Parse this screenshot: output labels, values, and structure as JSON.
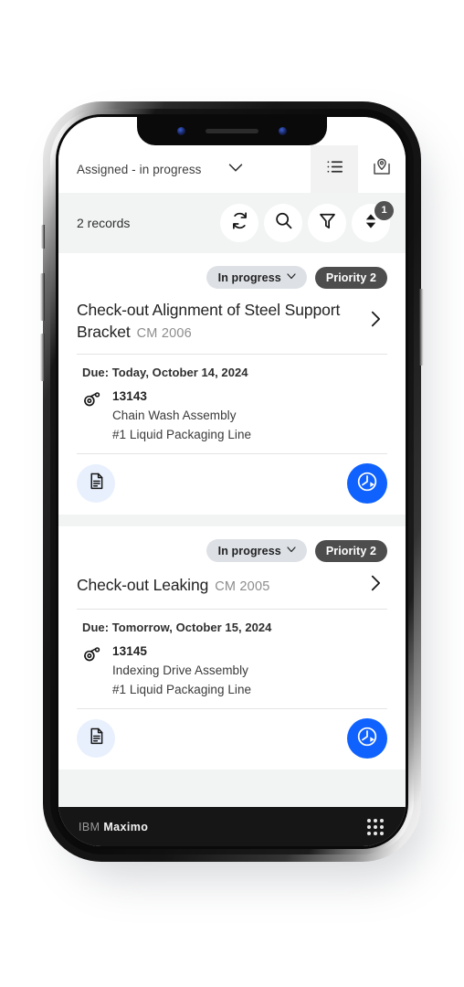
{
  "header": {
    "filter_label": "Assigned - in progress",
    "chevron_icon": "chevron-down-icon",
    "views": [
      {
        "name": "list-view",
        "icon": "list-icon",
        "active": true
      },
      {
        "name": "map-view",
        "icon": "map-pin-icon",
        "active": false
      }
    ]
  },
  "toolbar": {
    "records_text": "2 records",
    "actions": [
      {
        "name": "refresh",
        "icon": "refresh-icon"
      },
      {
        "name": "search",
        "icon": "search-icon"
      },
      {
        "name": "filter",
        "icon": "filter-icon"
      },
      {
        "name": "sort",
        "icon": "sort-icon",
        "badge": "1"
      }
    ]
  },
  "cards": [
    {
      "status": "In progress",
      "priority": "Priority 2",
      "title": "Check-out Alignment of Steel Support Bracket",
      "wonum": "CM 2006",
      "due": "Due: Today, October 14, 2024",
      "asset_number": "13143",
      "asset_name": "Chain Wash Assembly",
      "asset_location": "#1 Liquid Packaging Line",
      "doc_icon": "document-icon",
      "start_icon": "start-timer-icon"
    },
    {
      "status": "In progress",
      "priority": "Priority 2",
      "title": "Check-out Leaking",
      "wonum": "CM 2005",
      "due": "Due: Tomorrow, October 15, 2024",
      "asset_number": "13145",
      "asset_name": "Indexing Drive Assembly",
      "asset_location": "#1 Liquid Packaging Line",
      "doc_icon": "document-icon",
      "start_icon": "start-timer-icon"
    }
  ],
  "bottom_bar": {
    "brand_prefix": "IBM",
    "brand_name": "Maximo",
    "app_switcher_icon": "grid-dots-icon"
  },
  "colors": {
    "accent_blue": "#0f62fe",
    "accent_blue_soft": "#e8f0fe",
    "chip_status_bg": "#dde1e6",
    "chip_priority_bg": "#4d4d4d",
    "toolbar_bg": "#f2f4f4",
    "bottom_bar_bg": "#161616"
  }
}
